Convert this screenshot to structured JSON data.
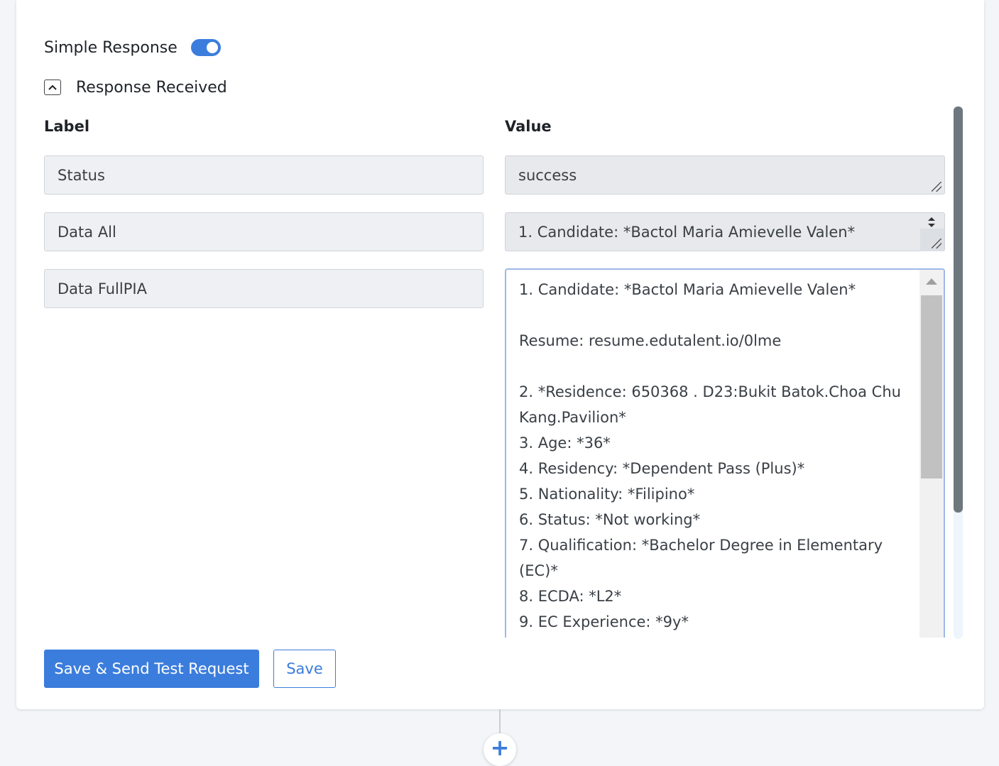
{
  "simple_response": {
    "label": "Simple Response",
    "enabled": true
  },
  "response_received": {
    "label": "Response Received",
    "collapse_glyph": "^"
  },
  "columns": {
    "label": "Label",
    "value": "Value"
  },
  "rows": [
    {
      "label": "Status",
      "value": "success"
    },
    {
      "label": "Data All",
      "value": "1. Candidate: *Bactol Maria Amievelle Valen*"
    },
    {
      "label": "Data FullPIA"
    }
  ],
  "fullpia_lines": [
    "1. Candidate: *Bactol Maria Amievelle Valen*",
    "",
    "Resume: resume.edutalent.io/0lme",
    "",
    "2. *Residence: 650368 . D23:Bukit Batok.Choa Chu Kang.Pavilion*",
    "3. Age: *36*",
    "4. Residency: *Dependent Pass (Plus)*",
    "5. Nationality: *Filipino*",
    "6. Status: *Not working*",
    "7. Qualification: *Bachelor Degree in Elementary (EC)*",
    "8. ECDA: *L2*",
    "9. EC Experience: *9y*"
  ],
  "buttons": {
    "save_send": "Save & Send Test Request",
    "save": "Save"
  },
  "icons": {
    "collapse": "chevron-up-icon",
    "add": "plus-icon"
  },
  "colors": {
    "primary": "#3b7ddd",
    "accent_top": "#d9534f"
  }
}
